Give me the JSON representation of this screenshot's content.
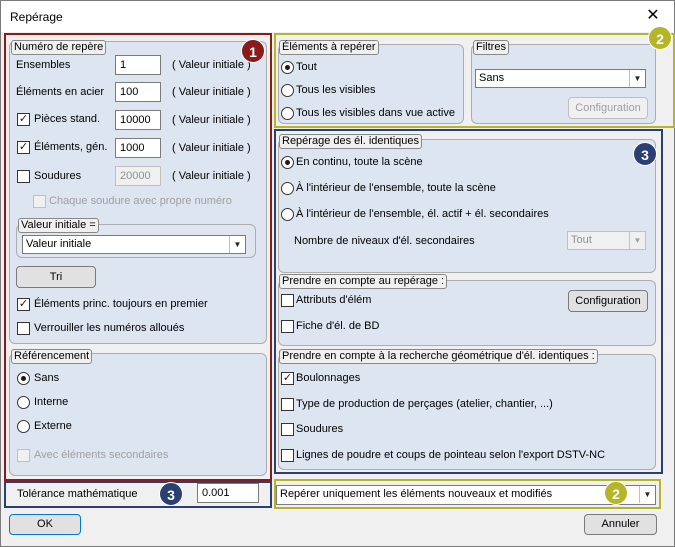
{
  "window": {
    "title": "Repérage",
    "close_glyph": "✕"
  },
  "numero": {
    "legend": "Numéro de repère",
    "rows": [
      {
        "label": "Ensembles",
        "value": "1",
        "suffix": "( Valeur initiale )"
      },
      {
        "label": "Éléments en acier",
        "value": "100",
        "suffix": "( Valeur initiale )"
      },
      {
        "label": "Pièces stand.",
        "value": "10000",
        "suffix": "( Valeur initiale )",
        "checked": true
      },
      {
        "label": "Éléments, gén.",
        "value": "1000",
        "suffix": "( Valeur initiale )",
        "checked": true
      },
      {
        "label": "Soudures",
        "value": "20000",
        "suffix": "( Valeur initiale )",
        "checked": false
      }
    ],
    "chaque_soudure": "Chaque soudure avec propre numéro",
    "valeur_initiale_legend": "Valeur initiale =",
    "valeur_initiale_value": "Valeur initiale",
    "tri_label": "Tri",
    "elements_princ": "Éléments princ. toujours en premier",
    "verrouiller": "Verrouiller les numéros alloués"
  },
  "referencement": {
    "legend": "Référencement",
    "options": [
      "Sans",
      "Interne",
      "Externe"
    ],
    "selected": "Sans",
    "avec_elements": "Avec éléments secondaires"
  },
  "tolerance": {
    "label": "Tolérance mathématique",
    "value": "0.001"
  },
  "elements_a_reperer": {
    "legend": "Éléments à repérer",
    "options": [
      "Tout",
      "Tous les visibles",
      "Tous les visibles dans vue active"
    ],
    "selected": "Tout"
  },
  "filtres": {
    "legend": "Filtres",
    "value": "Sans",
    "config_label": "Configuration"
  },
  "identiques": {
    "legend": "Repérage des él. identiques",
    "options": [
      "En continu, toute la scène",
      "À l'intérieur de l'ensemble, toute la scène",
      "À l'intérieur de l'ensemble, él. actif + él. secondaires"
    ],
    "selected": "En continu, toute la scène",
    "niveaux_label": "Nombre de niveaux d'él. secondaires",
    "niveaux_value": "Tout"
  },
  "prendre_reperage": {
    "legend": "Prendre en compte au repérage :",
    "items": [
      "Attributs d'élém",
      "Fiche d'él. de BD"
    ],
    "config_label": "Configuration"
  },
  "prendre_geom": {
    "legend": "Prendre en compte à la recherche géométrique d'él. identiques :",
    "items": [
      {
        "label": "Boulonnages",
        "checked": true
      },
      {
        "label": "Type de production de perçages (atelier, chantier, ...)",
        "checked": false
      },
      {
        "label": "Soudures",
        "checked": false
      },
      {
        "label": "Lignes de poudre et coups de pointeau selon l'export DSTV-NC",
        "checked": false
      }
    ]
  },
  "mode": {
    "value": "Repérer uniquement les éléments nouveaux et modifiés"
  },
  "footer": {
    "ok_label": "OK",
    "cancel_label": "Annuler"
  },
  "badges": {
    "one": "1",
    "two": "2",
    "three": "3"
  },
  "colors": {
    "red": "#8b1a1a",
    "yellow": "#b5b52a",
    "blue": "#2b3f73"
  }
}
